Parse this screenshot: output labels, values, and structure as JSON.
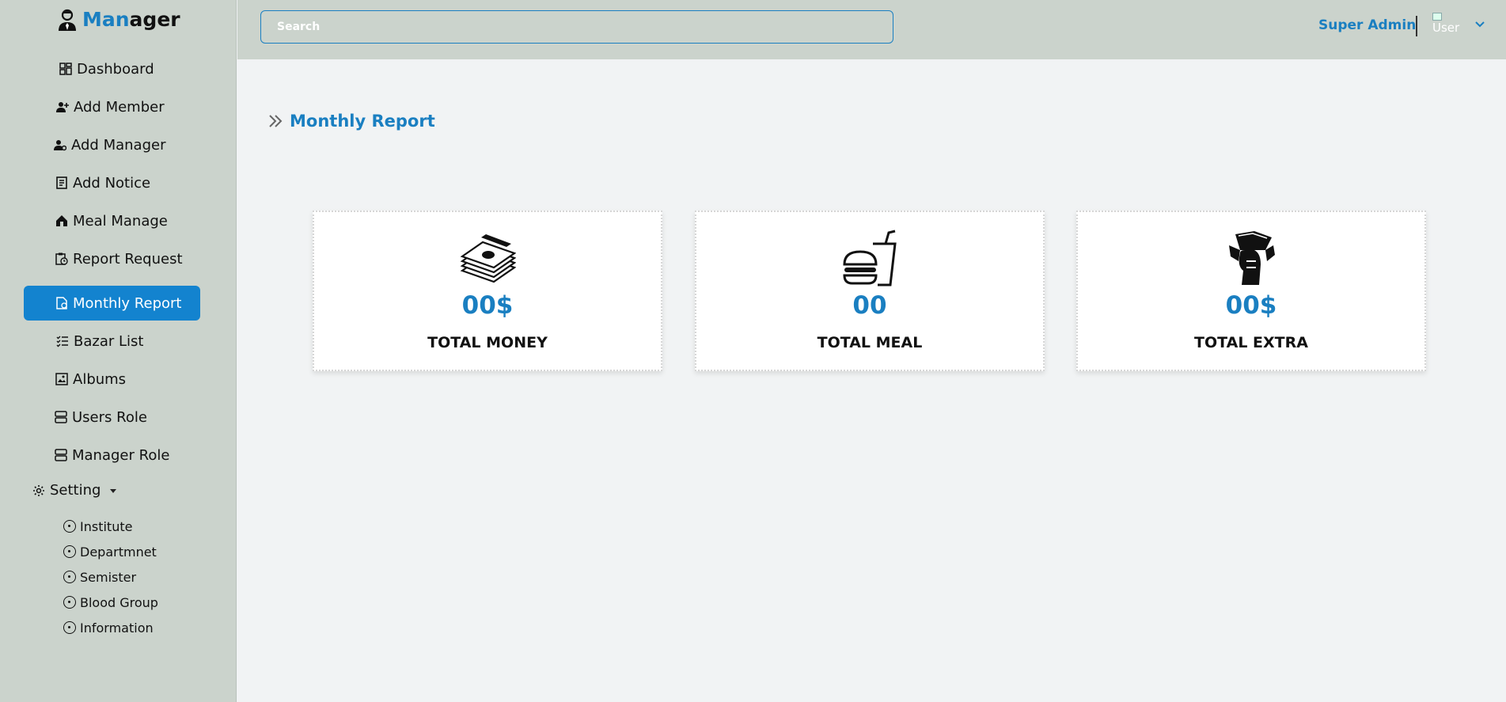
{
  "brand": {
    "name_part1": "Man",
    "name_part2": "ager"
  },
  "sidebar": {
    "items": [
      {
        "label": "Dashboard"
      },
      {
        "label": "Add Member"
      },
      {
        "label": "Add Manager"
      },
      {
        "label": "Add Notice"
      },
      {
        "label": "Meal Manage"
      },
      {
        "label": "Report Request"
      },
      {
        "label": "Monthly Report",
        "active": true
      },
      {
        "label": "Bazar List"
      },
      {
        "label": "Albums"
      },
      {
        "label": "Users Role"
      },
      {
        "label": "Manager Role"
      }
    ],
    "setting": {
      "label": "Setting",
      "subitems": [
        {
          "label": "Institute"
        },
        {
          "label": "Departmnet"
        },
        {
          "label": "Semister"
        },
        {
          "label": "Blood Group"
        },
        {
          "label": "Information"
        }
      ]
    }
  },
  "header": {
    "search_placeholder": "Search",
    "user_name": "Super Admin",
    "avatar_alt": "User"
  },
  "main": {
    "page_title": "Monthly Report",
    "cards": [
      {
        "icon": "money-stack-icon",
        "value": "00$",
        "label": "TOTAL MONEY"
      },
      {
        "icon": "burger-drink-icon",
        "value": "00",
        "label": "TOTAL MEAL"
      },
      {
        "icon": "hand-money-icon",
        "value": "00$",
        "label": "TOTAL EXTRA"
      }
    ]
  },
  "colors": {
    "accent": "#1a7fc1",
    "sidebar_bg": "#cbd3cc",
    "active_bg": "#1383cf",
    "page_bg": "#f1f3f4"
  }
}
